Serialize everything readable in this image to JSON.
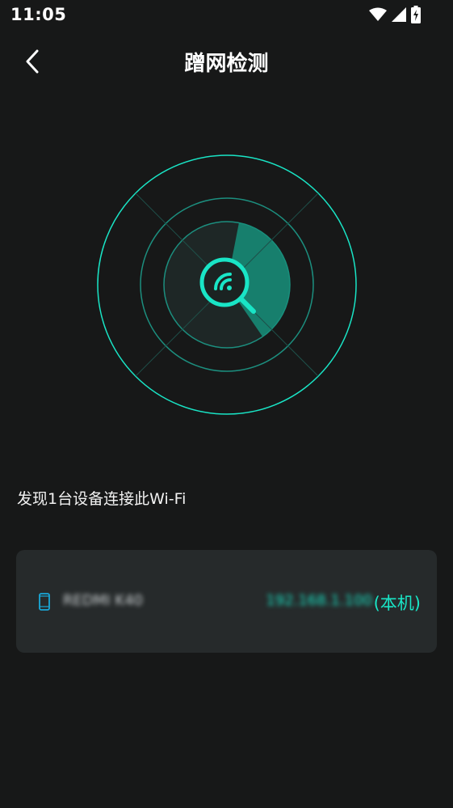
{
  "status_bar": {
    "time": "11:05",
    "icons": [
      "wifi-icon",
      "signal-icon",
      "battery-charging-icon"
    ]
  },
  "header": {
    "back_icon": "chevron-left-icon",
    "title": "蹭网检测"
  },
  "radar": {
    "center_icon": "wifi-search-icon",
    "accent_color": "#19e5c6"
  },
  "summary_text": "发现1台设备连接此Wi-Fi",
  "devices": [
    {
      "icon": "phone-icon",
      "name": "REDMI K40",
      "ip": "192.168.1.100",
      "self_label": "(本机)"
    }
  ]
}
